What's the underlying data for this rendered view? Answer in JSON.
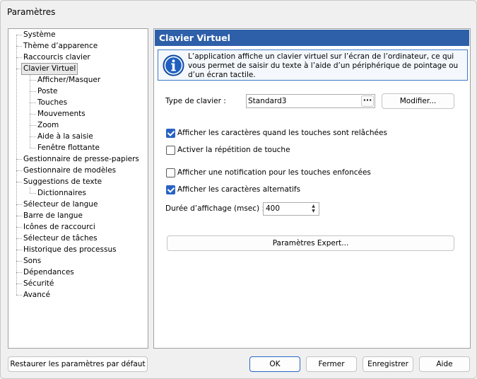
{
  "window": {
    "title": "Paramètres"
  },
  "tree": {
    "items": [
      {
        "label": "Système"
      },
      {
        "label": "Thème d’apparence"
      },
      {
        "label": "Raccourcis clavier"
      },
      {
        "label": "Clavier Virtuel"
      },
      {
        "label": "Afficher/Masquer"
      },
      {
        "label": "Poste"
      },
      {
        "label": "Touches"
      },
      {
        "label": "Mouvements"
      },
      {
        "label": "Zoom"
      },
      {
        "label": "Aide à la saisie"
      },
      {
        "label": "Fenêtre flottante"
      },
      {
        "label": "Gestionnaire de presse-papiers"
      },
      {
        "label": "Gestionnaire de modèles"
      },
      {
        "label": "Suggestions de texte"
      },
      {
        "label": "Dictionnaires"
      },
      {
        "label": "Sélecteur de langue"
      },
      {
        "label": "Barre de langue"
      },
      {
        "label": "Icônes de raccourci"
      },
      {
        "label": "Sélecteur de tâches"
      },
      {
        "label": "Historique des processus"
      },
      {
        "label": "Sons"
      },
      {
        "label": "Dépendances"
      },
      {
        "label": "Sécurité"
      },
      {
        "label": "Avancé"
      }
    ]
  },
  "panel": {
    "header": "Clavier Virtuel",
    "info_text": "L’application affiche un clavier virtuel sur l’écran de l’ordinateur, ce qui vous permet de saisir du texte à l’aide d’un périphérique de pointage ou d’un écran tactile.",
    "keyboard_type_label": "Type de clavier :",
    "keyboard_type_value": "Standard3",
    "combo_button_label": "···",
    "modify_button": "Modifier...",
    "options": [
      {
        "label": "Afficher les caractères quand les touches sont relâchées",
        "checked": true
      },
      {
        "label": "Activer la répétition de touche",
        "checked": false
      },
      {
        "label": "Afficher une notification pour les touches enfoncées",
        "checked": false
      },
      {
        "label": "Afficher les caractères alternatifs",
        "checked": true
      }
    ],
    "duration_label": "Durée d’affichage (msec) :",
    "duration_value": "400",
    "expert_button": "Paramètres Expert..."
  },
  "footer": {
    "restore_button": "Restaurer les paramètres par défaut",
    "ok_button": "OK",
    "close_button": "Fermer",
    "save_button": "Enregistrer",
    "help_button": "Aide"
  },
  "colors": {
    "header_bg": "#2e5fa9",
    "accent": "#2962c4",
    "info_border": "#3c78c8"
  }
}
